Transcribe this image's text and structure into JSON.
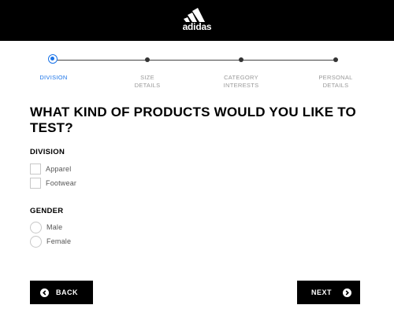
{
  "header": {
    "logo_text": "adidas"
  },
  "stepper": {
    "steps": [
      {
        "label_line1": "DIVISION",
        "label_line2": "",
        "active": true
      },
      {
        "label_line1": "SIZE",
        "label_line2": "DETAILS",
        "active": false
      },
      {
        "label_line1": "CATEGORY",
        "label_line2": "INTERESTS",
        "active": false
      },
      {
        "label_line1": "PERSONAL",
        "label_line2": "DETAILS",
        "active": false
      }
    ]
  },
  "question": "WHAT KIND OF PRODUCTS WOULD YOU LIKE TO TEST?",
  "division": {
    "title": "DIVISION",
    "options": [
      {
        "label": "Apparel",
        "checked": false
      },
      {
        "label": "Footwear",
        "checked": false
      }
    ]
  },
  "gender": {
    "title": "GENDER",
    "options": [
      {
        "label": "Male",
        "selected": false
      },
      {
        "label": "Female",
        "selected": false
      }
    ]
  },
  "buttons": {
    "back_label": "BACK",
    "next_label": "NEXT"
  },
  "colors": {
    "header_bg": "#000000",
    "accent": "#1a73e8",
    "button_bg": "#000000"
  },
  "icons": {
    "back": "chevron-left-circle-icon",
    "next": "chevron-right-circle-icon"
  }
}
